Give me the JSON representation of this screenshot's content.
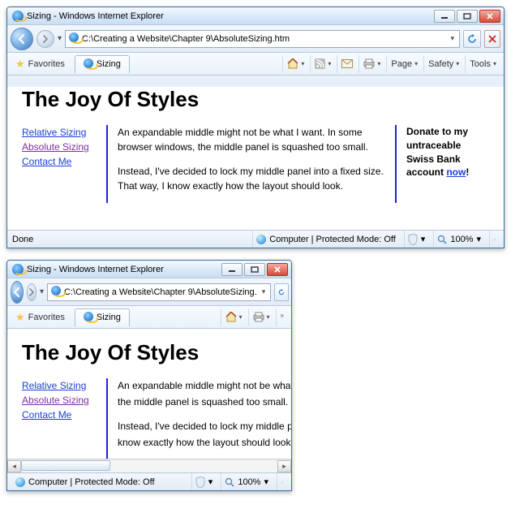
{
  "window_title": "Sizing - Windows Internet Explorer",
  "address": "C:\\Creating a Website\\Chapter 9\\AbsoluteSizing.htm",
  "address_truncated": "C:\\Creating a Website\\Chapter 9\\AbsoluteSizing.",
  "favorites_label": "Favorites",
  "tab_label": "Sizing",
  "cmd": {
    "page": "Page",
    "safety": "Safety",
    "tools": "Tools"
  },
  "page": {
    "heading": "The Joy Of Styles",
    "links": {
      "relative": "Relative Sizing",
      "absolute": "Absolute Sizing",
      "contact": "Contact Me"
    },
    "para1": "An expandable middle might not be what I want. In some browser windows, the middle panel is squashed too small.",
    "para2": "Instead, I've decided to lock my middle panel into a fixed size. That way, I know exactly how the layout should look.",
    "para1_a": "An expandable middle might not be what I want. In",
    "para1_b": "the middle panel is squashed too small.",
    "para2_a": "Instead, I've decided to lock my middle panel into",
    "para2_b": "know exactly how the layout should look.",
    "donate_a": "Donate to my untraceable Swiss Bank account ",
    "donate_now": "now"
  },
  "status": {
    "done": "Done",
    "mode": "Computer | Protected Mode: Off",
    "zoom": "100%"
  }
}
